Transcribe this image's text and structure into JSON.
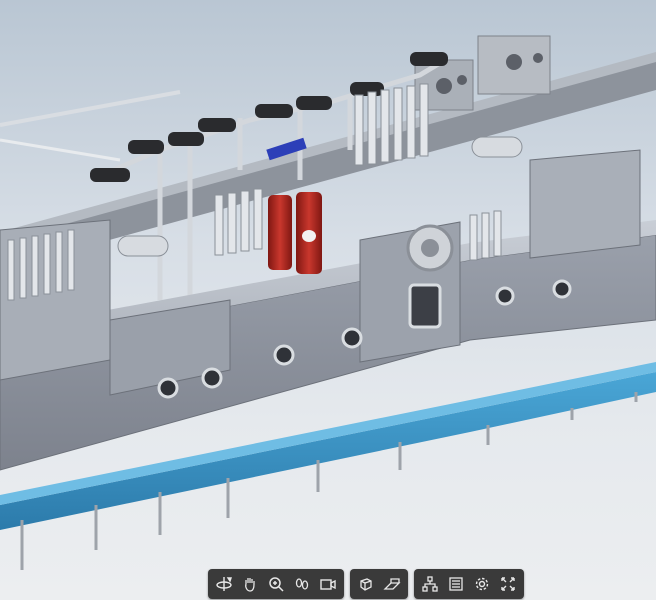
{
  "viewer": {
    "name": "3d-model-viewport",
    "scene_name": "filling-machine-3d-model"
  },
  "toolbar": {
    "groups": [
      {
        "name": "navigation-tools",
        "tools": [
          "orbit-icon",
          "pan-icon",
          "zoom-icon",
          "walk-icon",
          "camera-icon"
        ]
      },
      {
        "name": "model-tools",
        "tools": [
          "explode-icon",
          "section-icon"
        ]
      },
      {
        "name": "panel-tools",
        "tools": [
          "model-tree-icon",
          "properties-icon",
          "settings-icon",
          "fullscreen-icon"
        ]
      }
    ]
  },
  "colors": {
    "background_top": "#b9c6d3",
    "background_bottom": "#eceef0",
    "machine_body": "#8a8f9a",
    "conveyor": "#3f93c4",
    "red_tanks": "#b5261f",
    "blue_pipe": "#2c3fb8",
    "toolbar_bg": "#3a3a3a",
    "toolbar_icon": "#e8e8e8"
  }
}
